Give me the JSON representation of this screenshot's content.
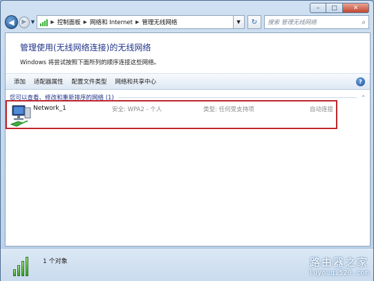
{
  "window": {
    "caption_buttons": {
      "minimize": "–",
      "maximize": "□",
      "close": "✕"
    }
  },
  "navbar": {
    "back_glyph": "◀",
    "forward_glyph": "▶",
    "dropdown_glyph": "▼",
    "breadcrumbs": [
      "控制面板",
      "网络和 Internet",
      "管理无线网络"
    ],
    "address_icon": "signal-bars-icon",
    "refresh_glyph": "↻",
    "search_placeholder": "搜索 管理无线网络"
  },
  "main": {
    "heading": "管理使用(无线网络连接)的无线网络",
    "subheading": "Windows 将尝试按照下面所列的顺序连接这些网络。",
    "toolbar": [
      "添加",
      "适配器属性",
      "配置文件类型",
      "网络和共享中心"
    ],
    "help_glyph": "?",
    "group_title": "您可以查看、修改和重新排序的网络 (1)",
    "networks": [
      {
        "name": "Network_1",
        "security": "安全: WPA2 - 个人",
        "type": "类型: 任何受支持项",
        "connect": "自动连接"
      }
    ]
  },
  "statusbar": {
    "count": "1 个对象",
    "watermark_cn": "路由器之家",
    "watermark_url": "luyouqi520.com"
  },
  "colors": {
    "heading": "#1e3287",
    "highlight_border": "#c0242c",
    "muted_text": "#8a8a8a"
  }
}
